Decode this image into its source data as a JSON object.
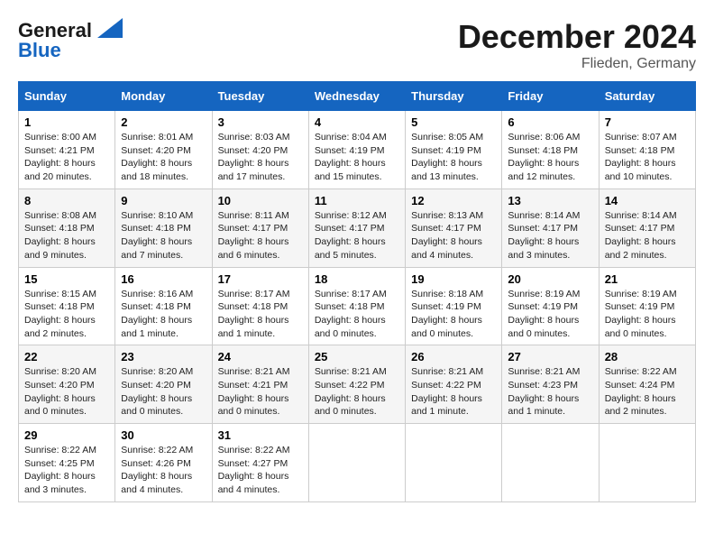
{
  "logo": {
    "line1": "General",
    "line2": "Blue"
  },
  "title": "December 2024",
  "subtitle": "Flieden, Germany",
  "days_of_week": [
    "Sunday",
    "Monday",
    "Tuesday",
    "Wednesday",
    "Thursday",
    "Friday",
    "Saturday"
  ],
  "weeks": [
    [
      {
        "day": "1",
        "sunrise": "8:00 AM",
        "sunset": "4:21 PM",
        "daylight": "8 hours and 20 minutes."
      },
      {
        "day": "2",
        "sunrise": "8:01 AM",
        "sunset": "4:20 PM",
        "daylight": "8 hours and 18 minutes."
      },
      {
        "day": "3",
        "sunrise": "8:03 AM",
        "sunset": "4:20 PM",
        "daylight": "8 hours and 17 minutes."
      },
      {
        "day": "4",
        "sunrise": "8:04 AM",
        "sunset": "4:19 PM",
        "daylight": "8 hours and 15 minutes."
      },
      {
        "day": "5",
        "sunrise": "8:05 AM",
        "sunset": "4:19 PM",
        "daylight": "8 hours and 13 minutes."
      },
      {
        "day": "6",
        "sunrise": "8:06 AM",
        "sunset": "4:18 PM",
        "daylight": "8 hours and 12 minutes."
      },
      {
        "day": "7",
        "sunrise": "8:07 AM",
        "sunset": "4:18 PM",
        "daylight": "8 hours and 10 minutes."
      }
    ],
    [
      {
        "day": "8",
        "sunrise": "8:08 AM",
        "sunset": "4:18 PM",
        "daylight": "8 hours and 9 minutes."
      },
      {
        "day": "9",
        "sunrise": "8:10 AM",
        "sunset": "4:18 PM",
        "daylight": "8 hours and 7 minutes."
      },
      {
        "day": "10",
        "sunrise": "8:11 AM",
        "sunset": "4:17 PM",
        "daylight": "8 hours and 6 minutes."
      },
      {
        "day": "11",
        "sunrise": "8:12 AM",
        "sunset": "4:17 PM",
        "daylight": "8 hours and 5 minutes."
      },
      {
        "day": "12",
        "sunrise": "8:13 AM",
        "sunset": "4:17 PM",
        "daylight": "8 hours and 4 minutes."
      },
      {
        "day": "13",
        "sunrise": "8:14 AM",
        "sunset": "4:17 PM",
        "daylight": "8 hours and 3 minutes."
      },
      {
        "day": "14",
        "sunrise": "8:14 AM",
        "sunset": "4:17 PM",
        "daylight": "8 hours and 2 minutes."
      }
    ],
    [
      {
        "day": "15",
        "sunrise": "8:15 AM",
        "sunset": "4:18 PM",
        "daylight": "8 hours and 2 minutes."
      },
      {
        "day": "16",
        "sunrise": "8:16 AM",
        "sunset": "4:18 PM",
        "daylight": "8 hours and 1 minute."
      },
      {
        "day": "17",
        "sunrise": "8:17 AM",
        "sunset": "4:18 PM",
        "daylight": "8 hours and 1 minute."
      },
      {
        "day": "18",
        "sunrise": "8:17 AM",
        "sunset": "4:18 PM",
        "daylight": "8 hours and 0 minutes."
      },
      {
        "day": "19",
        "sunrise": "8:18 AM",
        "sunset": "4:19 PM",
        "daylight": "8 hours and 0 minutes."
      },
      {
        "day": "20",
        "sunrise": "8:19 AM",
        "sunset": "4:19 PM",
        "daylight": "8 hours and 0 minutes."
      },
      {
        "day": "21",
        "sunrise": "8:19 AM",
        "sunset": "4:19 PM",
        "daylight": "8 hours and 0 minutes."
      }
    ],
    [
      {
        "day": "22",
        "sunrise": "8:20 AM",
        "sunset": "4:20 PM",
        "daylight": "8 hours and 0 minutes."
      },
      {
        "day": "23",
        "sunrise": "8:20 AM",
        "sunset": "4:20 PM",
        "daylight": "8 hours and 0 minutes."
      },
      {
        "day": "24",
        "sunrise": "8:21 AM",
        "sunset": "4:21 PM",
        "daylight": "8 hours and 0 minutes."
      },
      {
        "day": "25",
        "sunrise": "8:21 AM",
        "sunset": "4:22 PM",
        "daylight": "8 hours and 0 minutes."
      },
      {
        "day": "26",
        "sunrise": "8:21 AM",
        "sunset": "4:22 PM",
        "daylight": "8 hours and 1 minute."
      },
      {
        "day": "27",
        "sunrise": "8:21 AM",
        "sunset": "4:23 PM",
        "daylight": "8 hours and 1 minute."
      },
      {
        "day": "28",
        "sunrise": "8:22 AM",
        "sunset": "4:24 PM",
        "daylight": "8 hours and 2 minutes."
      }
    ],
    [
      {
        "day": "29",
        "sunrise": "8:22 AM",
        "sunset": "4:25 PM",
        "daylight": "8 hours and 3 minutes."
      },
      {
        "day": "30",
        "sunrise": "8:22 AM",
        "sunset": "4:26 PM",
        "daylight": "8 hours and 4 minutes."
      },
      {
        "day": "31",
        "sunrise": "8:22 AM",
        "sunset": "4:27 PM",
        "daylight": "8 hours and 4 minutes."
      },
      null,
      null,
      null,
      null
    ]
  ],
  "labels": {
    "sunrise": "Sunrise:",
    "sunset": "Sunset:",
    "daylight": "Daylight:"
  }
}
